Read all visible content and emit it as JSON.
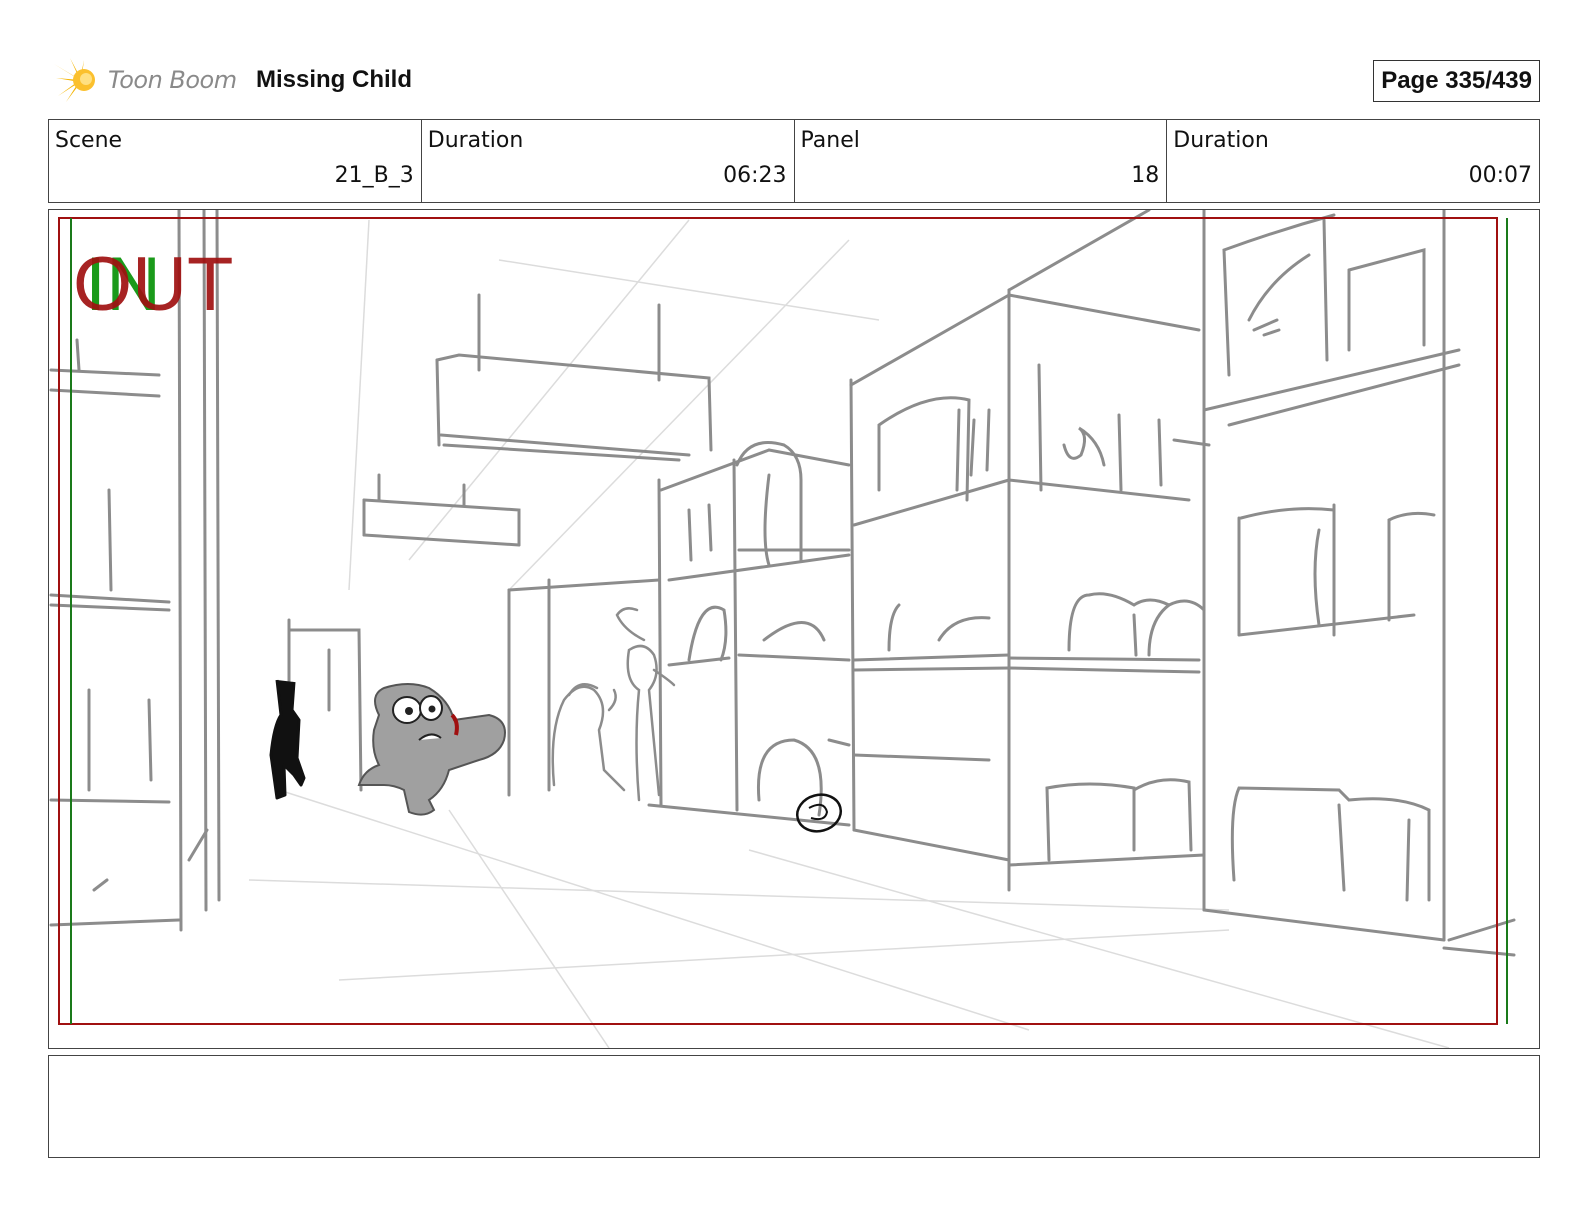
{
  "header": {
    "brand": "Toon Boom",
    "project_title": "Missing Child",
    "page_indicator": "Page 335/439"
  },
  "info": [
    {
      "label": "Scene",
      "value": "21_B_3"
    },
    {
      "label": "Duration",
      "value": "06:23"
    },
    {
      "label": "Panel",
      "value": "18"
    },
    {
      "label": "Duration",
      "value": "00:07"
    }
  ],
  "panel": {
    "in_label": "IN",
    "out_label": "OUT",
    "colors": {
      "out_marker": "#a01010",
      "in_marker": "#1a9a1a",
      "sketch_line": "#8c8c8c",
      "guide_line": "#dcdcdc",
      "character_fill": "#a0a0a0",
      "character_dark": "#111111"
    }
  },
  "notes": {
    "text": ""
  }
}
